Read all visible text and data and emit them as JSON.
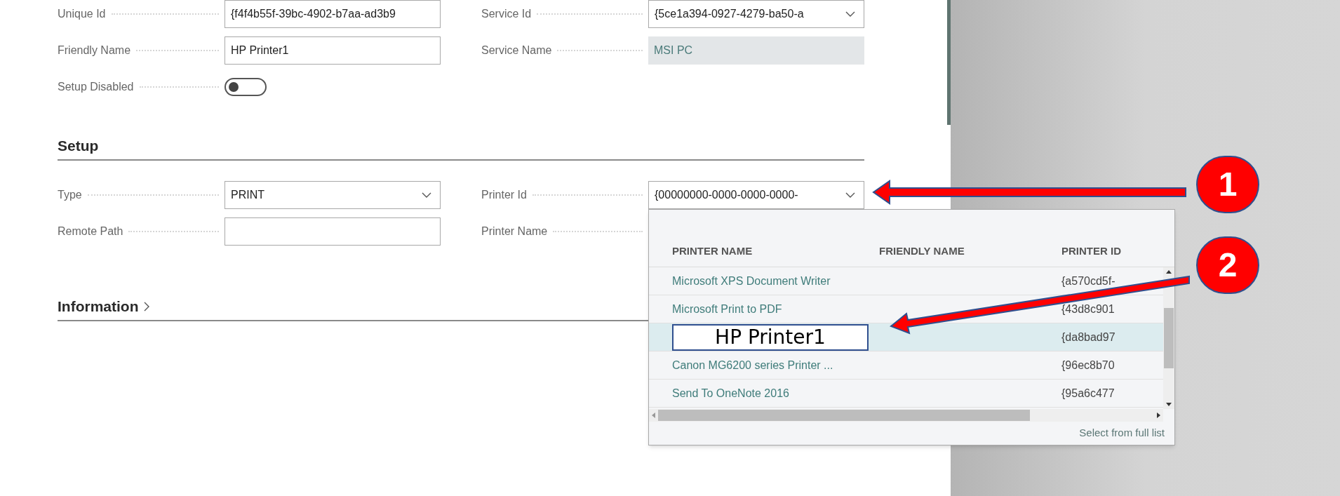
{
  "general": {
    "left": [
      {
        "label": "Unique Id",
        "kind": "text",
        "value": "{f4f4b55f-39bc-4902-b7aa-ad3b9"
      },
      {
        "label": "Friendly Name",
        "kind": "text",
        "value": "HP Printer1"
      },
      {
        "label": "Setup Disabled",
        "kind": "toggle",
        "on": false
      }
    ],
    "right": [
      {
        "label": "Service Id",
        "kind": "select",
        "value": "{5ce1a394-0927-4279-ba50-a"
      },
      {
        "label": "Service Name",
        "kind": "readonly",
        "value": "MSI PC"
      }
    ]
  },
  "setup": {
    "title": "Setup",
    "left": [
      {
        "label": "Type",
        "kind": "select",
        "value": "PRINT"
      },
      {
        "label": "Remote Path",
        "kind": "text"
      }
    ],
    "right": [
      {
        "label": "Printer Id",
        "kind": "select",
        "value": "{00000000-0000-0000-0000-"
      },
      {
        "label": "Printer Name",
        "kind": "covered"
      }
    ]
  },
  "information": {
    "title": "Information",
    "expanded": false
  },
  "printer_dropdown": {
    "columns": [
      "PRINTER NAME",
      "FRIENDLY NAME",
      "PRINTER ID"
    ],
    "rows": [
      {
        "name": "Microsoft XPS Document Writer",
        "printer_id": "{a570cd5f-",
        "selected": false
      },
      {
        "name": "Microsoft Print to PDF",
        "printer_id": "{43d8c901",
        "selected": false
      },
      {
        "printer_id": "{da8bad97",
        "selected": true
      },
      {
        "name": "Canon MG6200 series Printer ...",
        "printer_id": "{96ec8b70",
        "selected": false
      },
      {
        "name": "Send To OneNote 2016",
        "printer_id": "{95a6c477",
        "selected": false
      }
    ],
    "footer_link": "Select from full list"
  },
  "annotations": {
    "callouts": [
      "1",
      "2"
    ],
    "overlay_label": "HP Printer1"
  }
}
